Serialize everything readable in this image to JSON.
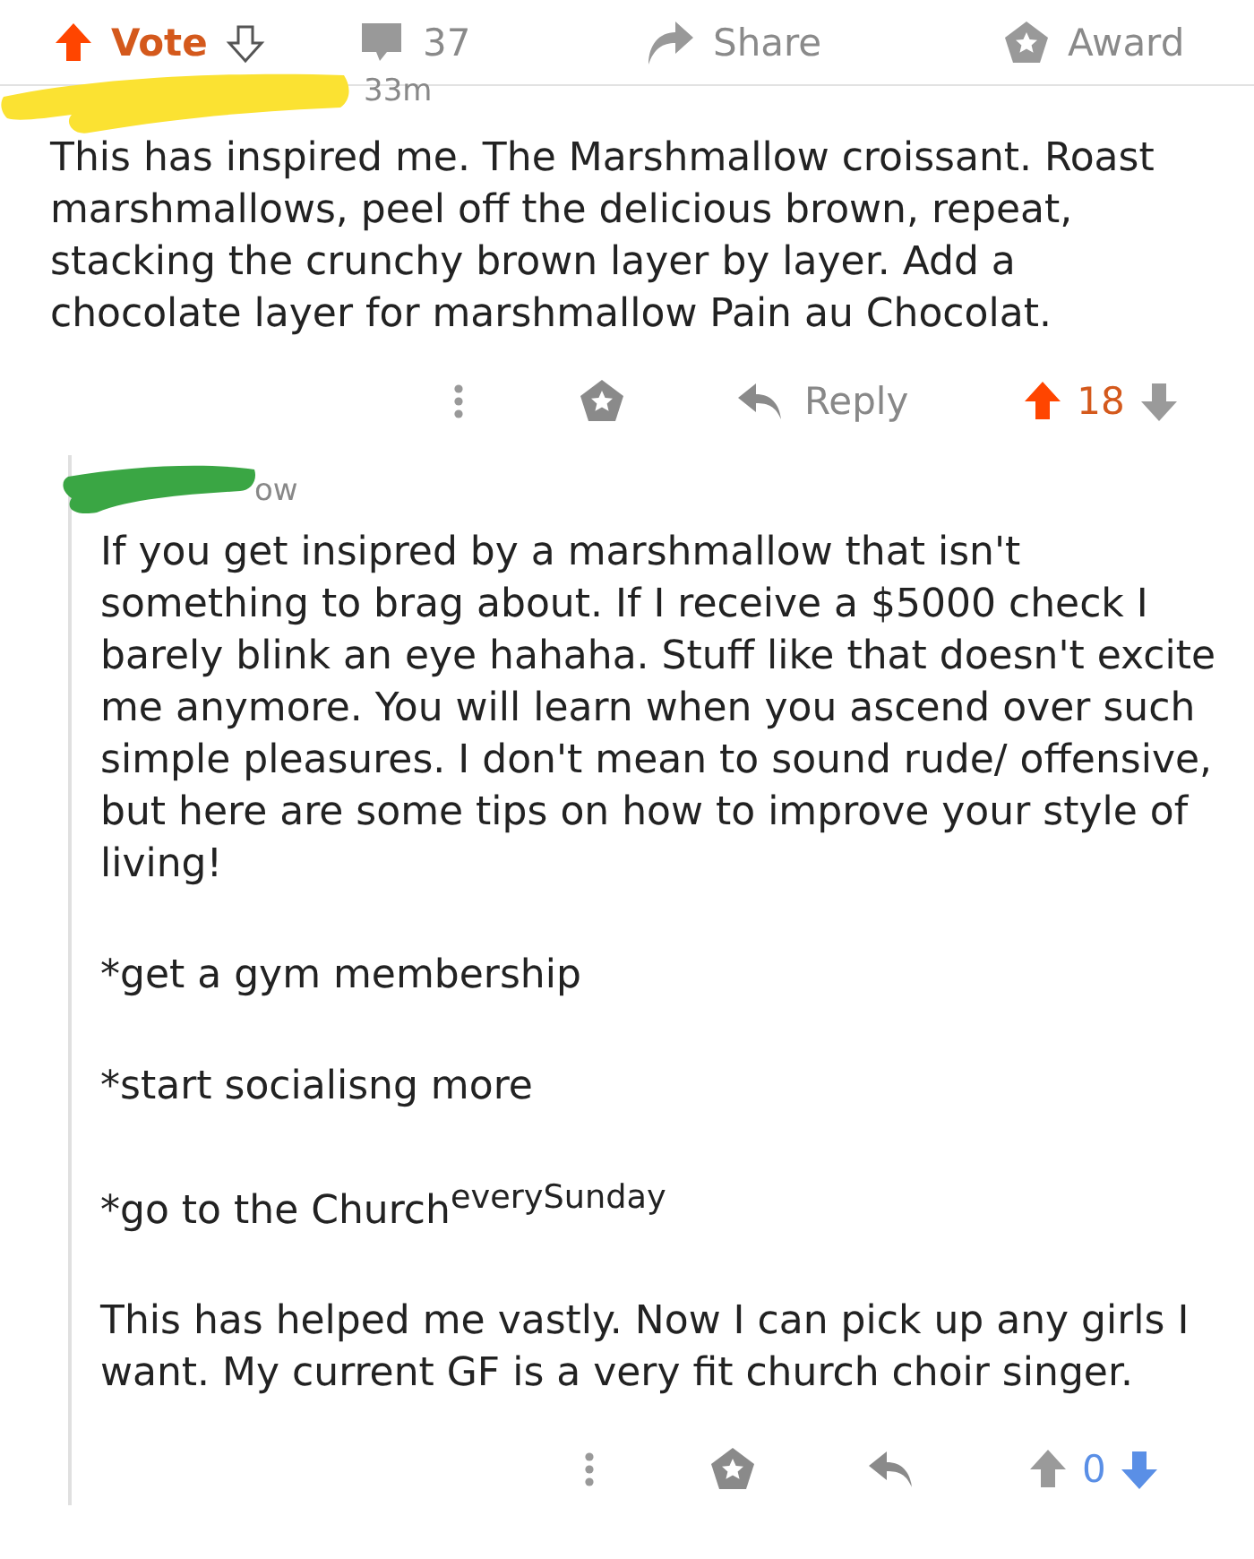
{
  "post_actions": {
    "vote_label": "Vote",
    "upvoted": true,
    "downvoted": false,
    "comment_count": "37",
    "share_label": "Share",
    "award_label": "Award"
  },
  "comments": [
    {
      "time": "33m",
      "body": [
        "This has inspired me. The Marshmallow croissant. Roast marshmallows, peel off the delicious brown, repeat, stacking the crunchy brown layer by layer. Add a chocolate layer for marshmallow Pain au Chocolat."
      ],
      "reply_label": "Reply",
      "score": "18",
      "upvoted": true,
      "downvoted": false,
      "children": [
        {
          "time": "ow",
          "body": [
            "If you get insipred by a marshmallow that isn't something to brag about. If I receive a $5000 check I barely blink an eye hahaha. Stuff like that doesn't excite me anymore. You will learn when you ascend over such simple pleasures. I don't mean to sound rude/ offensive, but here are some tips on how to improve your style of living!",
            "*get a gym membership",
            "*start socialisng more",
            "*go to the Church$^{everySunday}$",
            "This has helped me vastly. Now I can pick up any girls I want. My current GF is a very fit church choir singer."
          ],
          "score": "0",
          "upvoted": false,
          "downvoted": true
        }
      ]
    }
  ]
}
